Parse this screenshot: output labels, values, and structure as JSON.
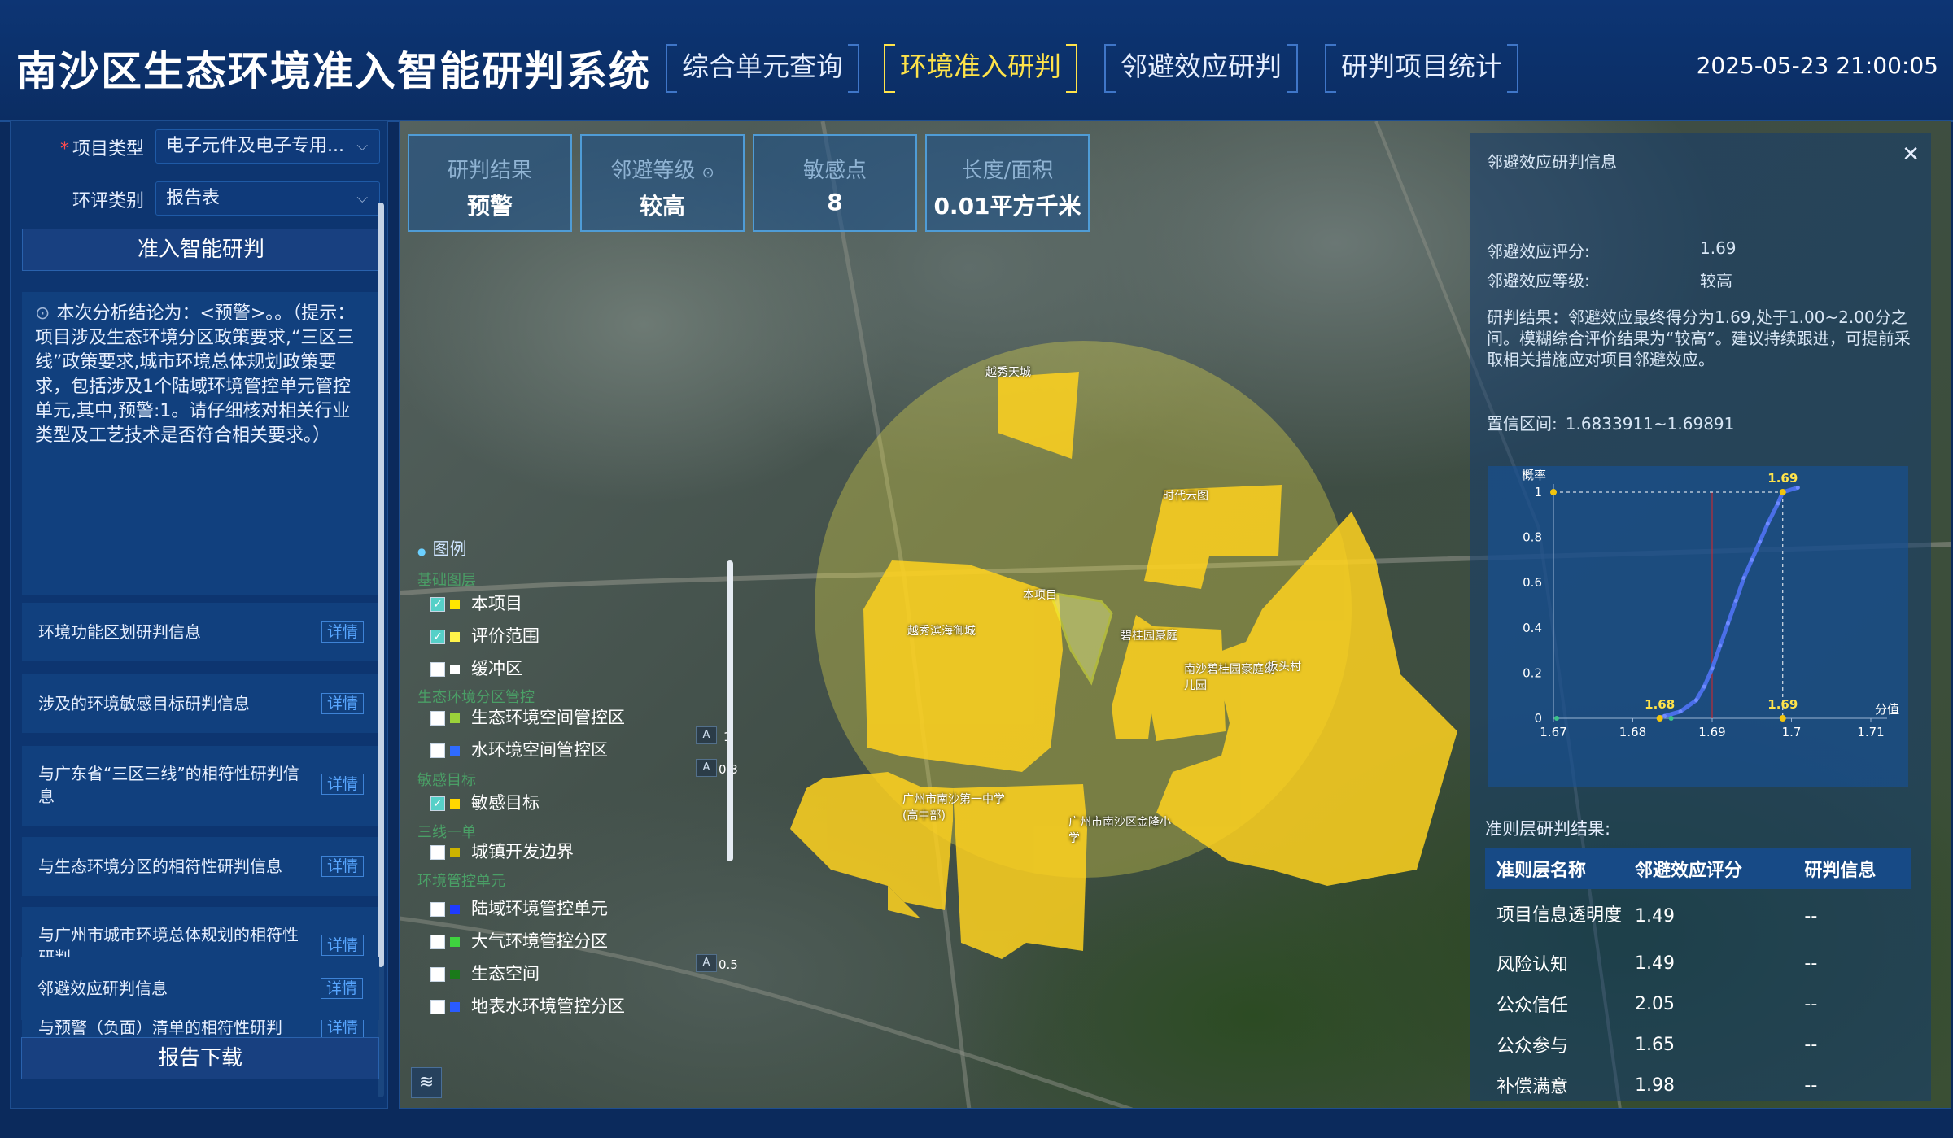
{
  "header": {
    "title": "南沙区生态环境准入智能研判系统",
    "tabs": [
      "综合单元查询",
      "环境准入研判",
      "邻避效应研判",
      "研判项目统计"
    ],
    "active_tab": "环境准入研判",
    "datetime": "2025-05-23 21:00:05"
  },
  "left": {
    "project_type_label": "项目类型",
    "project_type_value": "电子元件及电子专用...",
    "eia_label": "环评类别",
    "eia_value": "报告表",
    "analyze_button": "准入智能研判",
    "conclusion": "本次分析结论为：<预警>。。（提示：项目涉及生态环境分区政策要求,“三区三线”政策要求,城市环境总体规划政策要求，包括涉及1个陆域环境管控单元管控单元,其中,预警:1。请仔细核对相关行业类型及工艺技术是否符合相关要求。）",
    "info_items": [
      "环境功能区划研判信息",
      "涉及的环境敏感目标研判信息",
      "与广东省“三区三线”的相符性研判信息",
      "与生态环境分区的相符性研判信息",
      "与广州市城市环境总体规划的相符性研判",
      "与预警（负面）清单的相符性研判",
      "邻避效应研判信息"
    ],
    "detail_label": "详情",
    "download_button": "报告下载"
  },
  "stats": [
    {
      "key": "研判结果",
      "value": "预警"
    },
    {
      "key": "邻避等级",
      "value": "较高"
    },
    {
      "key": "敏感点",
      "value": "8"
    },
    {
      "key": "长度/面积",
      "value": "0.01平方千米"
    }
  ],
  "legend": {
    "title": "图例",
    "groups": [
      "基础图层",
      "生态环境分区管控",
      "敏感目标",
      "三线一单",
      "环境管控单元"
    ],
    "items": [
      {
        "label": "本项目",
        "checked": true,
        "color": "#ffe600",
        "opacity": "1"
      },
      {
        "label": "评价范围",
        "checked": true,
        "color": "#fff34a",
        "opacity": "0.3"
      },
      {
        "label": "缓冲区",
        "checked": false,
        "color": "#ffffff"
      },
      {
        "label": "生态环境空间管控区",
        "checked": false,
        "color": "#9bd23a"
      },
      {
        "label": "水环境空间管控区",
        "checked": false,
        "color": "#2f6bff"
      },
      {
        "label": "敏感目标",
        "checked": true,
        "color": "#ffd700",
        "opacity": "0.5"
      },
      {
        "label": "城镇开发边界",
        "checked": false,
        "color": "#ccb300"
      },
      {
        "label": "陆域环境管控单元",
        "checked": false,
        "color": "#1f3bff"
      },
      {
        "label": "大气环境管控分区",
        "checked": false,
        "color": "#3fd23f"
      },
      {
        "label": "生态空间",
        "checked": false,
        "color": "#1a7a1a"
      },
      {
        "label": "地表水环境管控分区",
        "checked": false,
        "color": "#2a5bff"
      }
    ]
  },
  "map_labels": [
    "越秀天城",
    "时代云图",
    "本项目",
    "越秀滨海御城",
    "碧桂园豪庭",
    "南沙碧桂园豪庭幼儿园",
    "板头村",
    "广州市南沙第一中学(高中部)",
    "广州市南沙区金隆小学"
  ],
  "nimby": {
    "panel_title": "邻避效应研判信息",
    "score_label": "邻避效应评分:",
    "score": "1.69",
    "level_label": "邻避效应等级:",
    "level": "较高",
    "result": "研判结果：邻避效应最终得分为1.69,处于1.00~2.00分之间。模糊综合评价结果为“较高”。建议持续跟进，可提前采取相关措施应对项目邻避效应。",
    "interval_label": "置信区间:",
    "interval": "1.6833911~1.69891",
    "criteria_title": "准则层研判结果:",
    "table_headers": [
      "准则层名称",
      "邻避效应评分",
      "研判信息"
    ],
    "table_rows": [
      [
        "项目信息透明度",
        "1.49",
        "--"
      ],
      [
        "风险认知",
        "1.49",
        "--"
      ],
      [
        "公众信任",
        "2.05",
        "--"
      ],
      [
        "公众参与",
        "1.65",
        "--"
      ],
      [
        "补偿满意",
        "1.98",
        "--"
      ]
    ]
  },
  "chart_data": {
    "type": "line",
    "xlabel": "分值",
    "ylabel": "概率",
    "xlim": [
      1.67,
      1.71
    ],
    "ylim": [
      0,
      1
    ],
    "x_ticks": [
      1.67,
      1.68,
      1.69,
      1.7,
      1.71
    ],
    "y_ticks": [
      0,
      0.2,
      0.4,
      0.6,
      0.8,
      1
    ],
    "series": [
      {
        "x": [
          1.6833,
          1.684,
          1.686,
          1.688,
          1.689,
          1.69,
          1.691,
          1.692,
          1.693,
          1.694,
          1.695,
          1.696,
          1.697,
          1.6983,
          1.6989,
          1.7008
        ],
        "y": [
          0.0,
          0.01,
          0.03,
          0.08,
          0.14,
          0.22,
          0.32,
          0.42,
          0.52,
          0.62,
          0.7,
          0.78,
          0.86,
          0.95,
          1.0,
          1.02
        ]
      }
    ],
    "annotations": [
      {
        "label": "1.69",
        "x": 1.6989,
        "y": 1.0
      },
      {
        "label": "1.68",
        "x": 1.6834,
        "y": 0.0
      },
      {
        "label": "1.69",
        "x": 1.6989,
        "y": 0.0
      }
    ],
    "reference_line_x": 1.69
  }
}
